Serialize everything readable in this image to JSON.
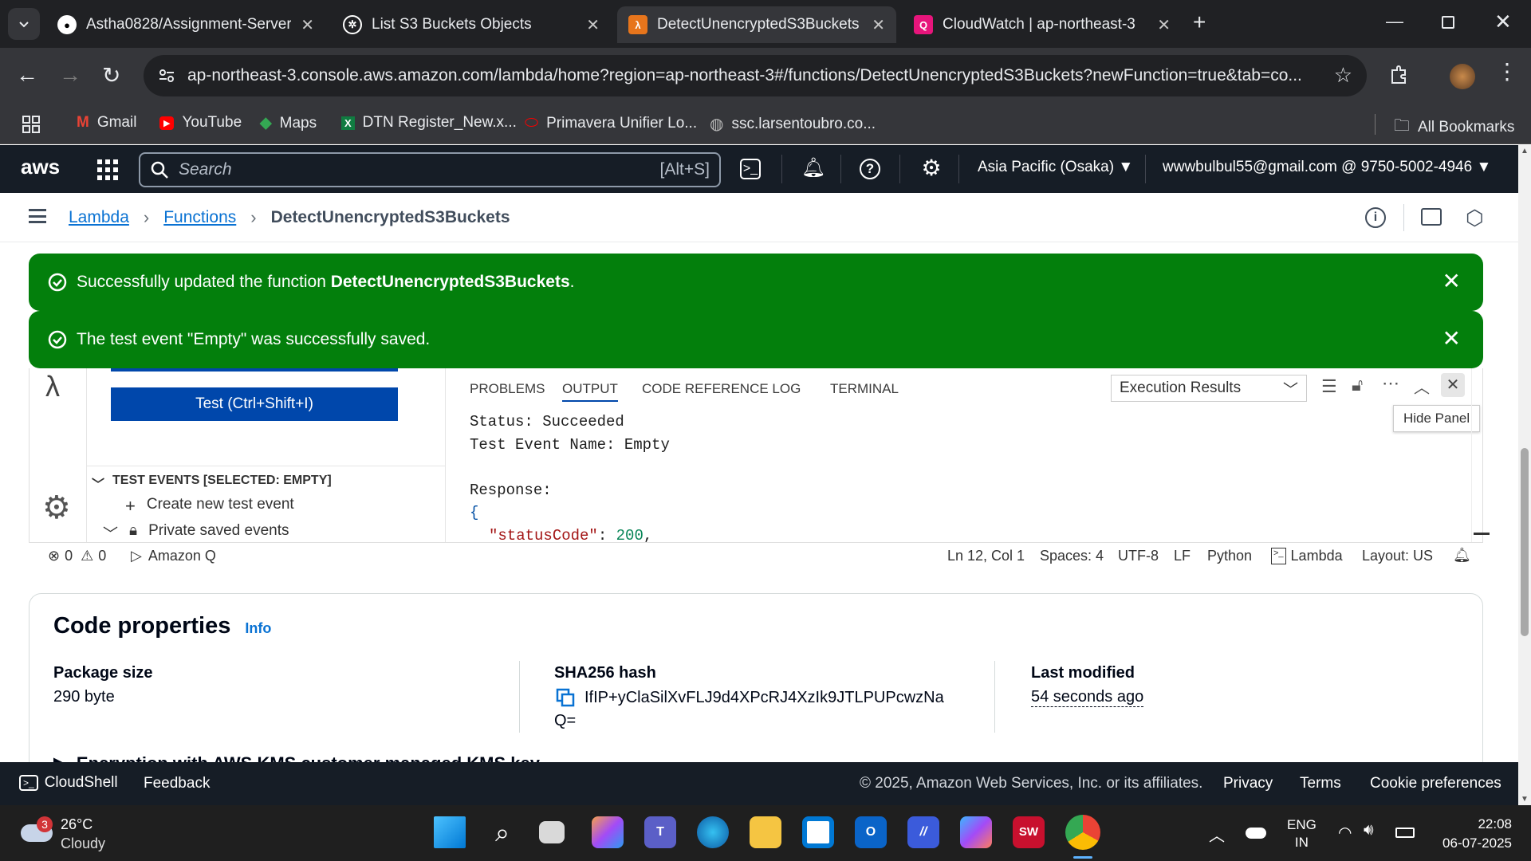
{
  "browser": {
    "tabs": [
      {
        "title": "Astha0828/Assignment-Serverl"
      },
      {
        "title": "List S3 Buckets Objects"
      },
      {
        "title": "DetectUnencryptedS3Buckets |"
      },
      {
        "title": "CloudWatch | ap-northeast-3"
      }
    ],
    "url": "ap-northeast-3.console.aws.amazon.com/lambda/home?region=ap-northeast-3#/functions/DetectUnencryptedS3Buckets?newFunction=true&tab=co...",
    "bookmarks": [
      "Gmail",
      "YouTube",
      "Maps",
      "DTN Register_New.x...",
      "Primavera Unifier Lo...",
      "ssc.larsentoubro.co..."
    ],
    "all_bookmarks": "All Bookmarks"
  },
  "aws": {
    "logo": "aws",
    "search_placeholder": "Search",
    "search_shortcut": "[Alt+S]",
    "region": "Asia Pacific (Osaka)",
    "account": "wwwbulbul55@gmail.com @ 9750-5002-4946"
  },
  "breadcrumb": {
    "lambda": "Lambda",
    "functions": "Functions",
    "current": "DetectUnencryptedS3Buckets"
  },
  "flash": {
    "update_prefix": "Successfully updated the function ",
    "update_name": "DetectUnencryptedS3Buckets",
    "update_suffix": ".",
    "saved": "The test event \"Empty\" was successfully saved."
  },
  "ide": {
    "test_button": "Test (Ctrl+Shift+I)",
    "test_events_header": "TEST EVENTS [SELECTED: EMPTY]",
    "create_event": "Create new test event",
    "private_events": "Private saved events",
    "panel_tabs": [
      "PROBLEMS",
      "OUTPUT",
      "CODE REFERENCE LOG",
      "TERMINAL"
    ],
    "results_select": "Execution Results",
    "hide_panel": "Hide Panel",
    "output": {
      "status": "Status: Succeeded",
      "event_name": "Test Event Name: Empty",
      "response": "Response:",
      "brace": "{",
      "key": "\"statusCode\"",
      "colon": ": ",
      "value": "200",
      "comma": ","
    },
    "status_bar": {
      "errors": "0",
      "warnings": "0",
      "amazon_q": "Amazon Q",
      "position": "Ln 12, Col 1",
      "spaces": "Spaces: 4",
      "encoding": "UTF-8",
      "eol": "LF",
      "language": "Python",
      "lambda": "Lambda",
      "layout": "Layout: US"
    }
  },
  "code_properties": {
    "title": "Code properties",
    "info": "Info",
    "package_label": "Package size",
    "package_value": "290 byte",
    "sha_label": "SHA256 hash",
    "sha_value": "IfIP+yClaSilXvFLJ9d4XPcRJ4XzIk9JTLPUPcwzNa",
    "sha_value2": "Q=",
    "modified_label": "Last modified",
    "modified_value": "54 seconds ago",
    "kms": "Encryption with AWS KMS customer managed KMS key"
  },
  "footer": {
    "cloudshell": "CloudShell",
    "feedback": "Feedback",
    "copyright": "© 2025, Amazon Web Services, Inc. or its affiliates.",
    "privacy": "Privacy",
    "terms": "Terms",
    "cookie": "Cookie preferences"
  },
  "taskbar": {
    "weather_temp": "26°C",
    "weather_desc": "Cloudy",
    "weather_badge": "3",
    "lang": "ENG",
    "region": "IN",
    "time": "22:08",
    "date": "06-07-2025"
  },
  "colors": {
    "aws_nav": "#161d26",
    "flash_green": "#037f0c",
    "link_blue": "#0972d3",
    "test_button": "#0047ab"
  }
}
